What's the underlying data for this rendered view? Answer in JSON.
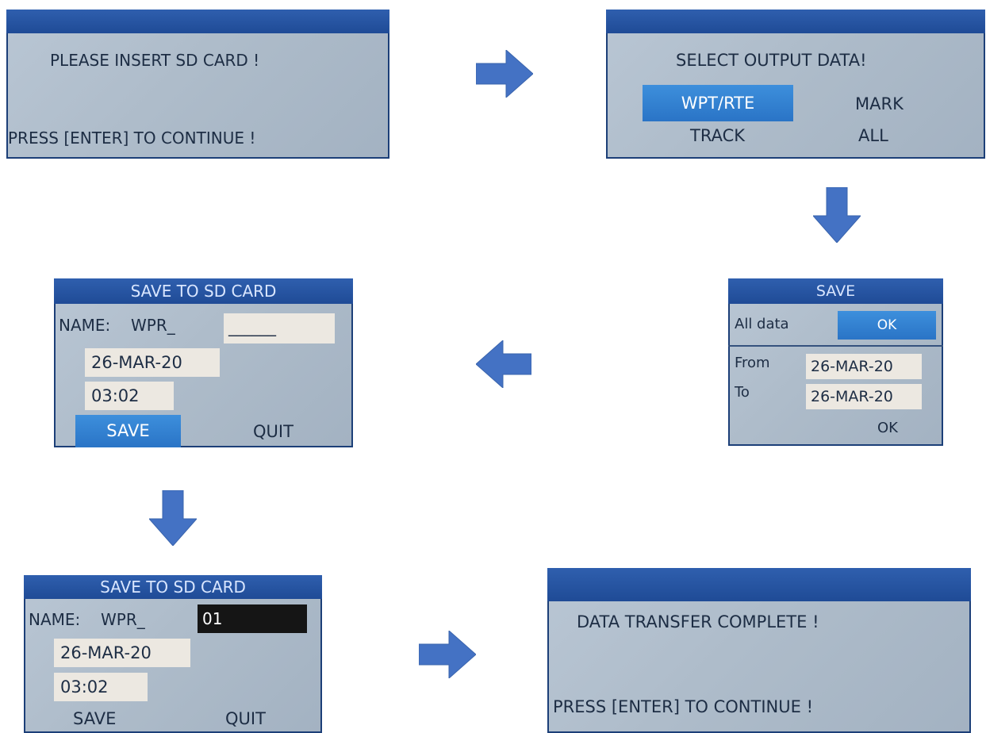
{
  "screens": {
    "insert_card": {
      "message": "PLEASE INSERT SD CARD !",
      "prompt": "PRESS [ENTER] TO CONTINUE !"
    },
    "select_output": {
      "title": "SELECT OUTPUT DATA!",
      "options": [
        "WPT/RTE",
        "MARK",
        "TRACK",
        "ALL"
      ],
      "selected": "WPT/RTE"
    },
    "save_dialog": {
      "title": "SAVE",
      "all_data_label": "All data",
      "ok_label": "OK",
      "from_label": "From",
      "from_value": "26-MAR-20",
      "to_label": "To",
      "to_value": "26-MAR-20",
      "ok_bottom_label": "OK"
    },
    "save_sd_blank": {
      "title": "SAVE TO SD CARD",
      "name_label": "NAME:",
      "name_prefix": "WPR_",
      "name_value": "______",
      "date": "26-MAR-20",
      "time": "03:02",
      "save_label": "SAVE",
      "quit_label": "QUIT"
    },
    "save_sd_filled": {
      "title": "SAVE TO SD CARD",
      "name_label": "NAME:",
      "name_prefix": "WPR_",
      "name_value": "01",
      "date": "26-MAR-20",
      "time": "03:02",
      "save_label": "SAVE",
      "quit_label": "QUIT"
    },
    "complete": {
      "message": "DATA TRANSFER COMPLETE !",
      "prompt": "PRESS [ENTER] TO CONTINUE !"
    }
  },
  "arrows": [
    "right-arrow-icon",
    "down-arrow-icon",
    "left-arrow-icon",
    "down-arrow-icon",
    "right-arrow-icon"
  ],
  "colors": {
    "arrow": "#4472c4",
    "titlebar": "#1f4b96",
    "highlight": "#2a74c6",
    "screen_bg": "#aebcca",
    "field_bg": "#ece8e1"
  }
}
